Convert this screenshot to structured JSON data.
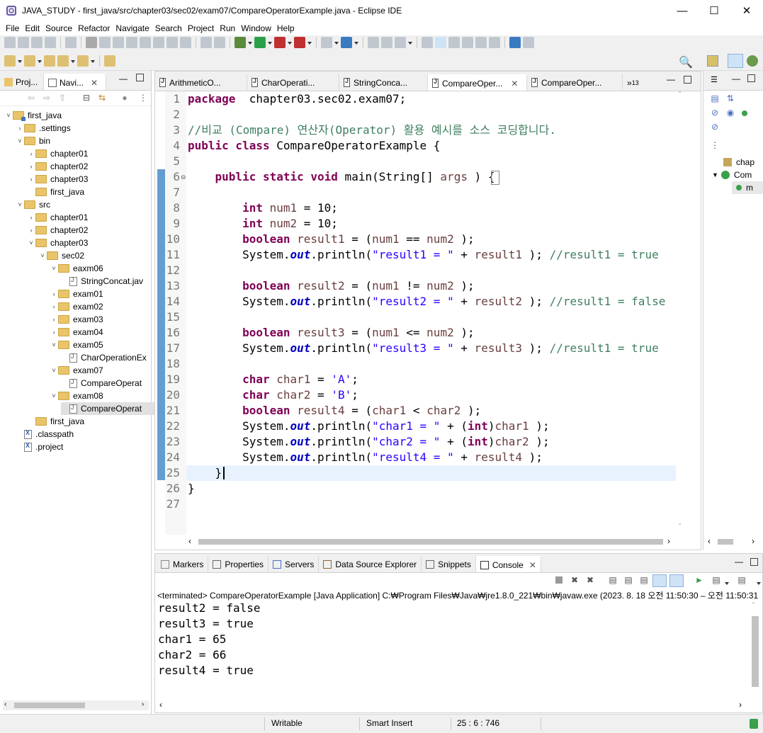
{
  "window": {
    "title": "JAVA_STUDY - first_java/src/chapter03/sec02/exam07/CompareOperatorExample.java - Eclipse IDE"
  },
  "menu": [
    "File",
    "Edit",
    "Source",
    "Refactor",
    "Navigate",
    "Search",
    "Project",
    "Run",
    "Window",
    "Help"
  ],
  "left_panel": {
    "tabs": [
      {
        "label": "Proj..."
      },
      {
        "label": "Navi..."
      }
    ],
    "tree": [
      {
        "label": "first_java",
        "depth": 0,
        "expanded": true,
        "icon": "project-icon"
      },
      {
        "label": ".settings",
        "depth": 1,
        "expanded": false,
        "icon": "folder-icon"
      },
      {
        "label": "bin",
        "depth": 1,
        "expanded": true,
        "icon": "folder-icon"
      },
      {
        "label": "chapter01",
        "depth": 2,
        "expanded": false,
        "icon": "folder-icon"
      },
      {
        "label": "chapter02",
        "depth": 2,
        "expanded": false,
        "icon": "folder-icon"
      },
      {
        "label": "chapter03",
        "depth": 2,
        "expanded": false,
        "icon": "folder-icon"
      },
      {
        "label": "first_java",
        "depth": 2,
        "expanded": null,
        "icon": "folder-icon"
      },
      {
        "label": "src",
        "depth": 1,
        "expanded": true,
        "icon": "folder-icon"
      },
      {
        "label": "chapter01",
        "depth": 2,
        "expanded": false,
        "icon": "folder-icon"
      },
      {
        "label": "chapter02",
        "depth": 2,
        "expanded": false,
        "icon": "folder-icon"
      },
      {
        "label": "chapter03",
        "depth": 2,
        "expanded": true,
        "icon": "folder-icon"
      },
      {
        "label": "sec02",
        "depth": 3,
        "expanded": true,
        "icon": "folder-icon"
      },
      {
        "label": "eaxm06",
        "depth": 4,
        "expanded": true,
        "icon": "folder-icon"
      },
      {
        "label": "StringConcat.jav",
        "depth": 5,
        "expanded": null,
        "icon": "java-file-icon"
      },
      {
        "label": "exam01",
        "depth": 4,
        "expanded": false,
        "icon": "folder-icon"
      },
      {
        "label": "exam02",
        "depth": 4,
        "expanded": false,
        "icon": "folder-icon"
      },
      {
        "label": "exam03",
        "depth": 4,
        "expanded": false,
        "icon": "folder-icon"
      },
      {
        "label": "exam04",
        "depth": 4,
        "expanded": false,
        "icon": "folder-icon"
      },
      {
        "label": "exam05",
        "depth": 4,
        "expanded": true,
        "icon": "folder-icon"
      },
      {
        "label": "CharOperationEx",
        "depth": 5,
        "expanded": null,
        "icon": "java-file-icon"
      },
      {
        "label": "exam07",
        "depth": 4,
        "expanded": true,
        "icon": "folder-icon"
      },
      {
        "label": "CompareOperat",
        "depth": 5,
        "expanded": null,
        "icon": "java-file-icon"
      },
      {
        "label": "exam08",
        "depth": 4,
        "expanded": true,
        "icon": "folder-icon"
      },
      {
        "label": "CompareOperat",
        "depth": 5,
        "expanded": null,
        "icon": "java-file-icon",
        "selected": true
      },
      {
        "label": "first_java",
        "depth": 2,
        "expanded": null,
        "icon": "folder-icon"
      },
      {
        "label": ".classpath",
        "depth": 1,
        "expanded": null,
        "icon": "xml-file-icon"
      },
      {
        "label": ".project",
        "depth": 1,
        "expanded": null,
        "icon": "xml-file-icon"
      }
    ]
  },
  "editor": {
    "tabs": [
      {
        "label": "ArithmeticO...",
        "active": false
      },
      {
        "label": "CharOperati...",
        "active": false
      },
      {
        "label": "StringConca...",
        "active": false
      },
      {
        "label": "CompareOper...",
        "active": true
      },
      {
        "label": "CompareOper...",
        "active": false
      }
    ],
    "overflow_label": "»",
    "overflow_count": "13",
    "lines": [
      {
        "n": "1",
        "tokens": [
          [
            "kw",
            "package"
          ],
          [
            "",
            "  chapter03.sec02.exam07;"
          ]
        ]
      },
      {
        "n": "2",
        "tokens": []
      },
      {
        "n": "3",
        "tokens": [
          [
            "cmt",
            "//비교 (Compare) 연산자(Operator) 활용 예시를 소스 코딩합니다."
          ]
        ]
      },
      {
        "n": "4",
        "tokens": [
          [
            "kw",
            "public class"
          ],
          [
            "",
            " CompareOperatorExample {"
          ]
        ]
      },
      {
        "n": "5",
        "tokens": []
      },
      {
        "n": "6",
        "tokens": [
          [
            "",
            "    "
          ],
          [
            "kw",
            "public static void"
          ],
          [
            "",
            " main(String[] "
          ],
          [
            "var",
            "args"
          ],
          [
            "",
            " ) {"
          ]
        ]
      },
      {
        "n": "7",
        "tokens": []
      },
      {
        "n": "8",
        "tokens": [
          [
            "",
            "        "
          ],
          [
            "kw",
            "int"
          ],
          [
            "",
            " "
          ],
          [
            "var",
            "num1"
          ],
          [
            "",
            " = 10;"
          ]
        ]
      },
      {
        "n": "9",
        "tokens": [
          [
            "",
            "        "
          ],
          [
            "kw",
            "int"
          ],
          [
            "",
            " "
          ],
          [
            "var",
            "num2"
          ],
          [
            "",
            " = 10;"
          ]
        ]
      },
      {
        "n": "10",
        "tokens": [
          [
            "",
            "        "
          ],
          [
            "kw",
            "boolean"
          ],
          [
            "",
            " "
          ],
          [
            "var",
            "result1"
          ],
          [
            "",
            " = ("
          ],
          [
            "var",
            "num1"
          ],
          [
            "",
            " == "
          ],
          [
            "var",
            "num2"
          ],
          [
            "",
            " );"
          ]
        ]
      },
      {
        "n": "11",
        "tokens": [
          [
            "",
            "        System."
          ],
          [
            "fld",
            "out"
          ],
          [
            "",
            ".println("
          ],
          [
            "str",
            "\"result1 = \""
          ],
          [
            "",
            " + "
          ],
          [
            "var",
            "result1"
          ],
          [
            "",
            " ); "
          ],
          [
            "cmt",
            "//result1 = true"
          ]
        ]
      },
      {
        "n": "12",
        "tokens": []
      },
      {
        "n": "13",
        "tokens": [
          [
            "",
            "        "
          ],
          [
            "kw",
            "boolean"
          ],
          [
            "",
            " "
          ],
          [
            "var",
            "result2"
          ],
          [
            "",
            " = ("
          ],
          [
            "var",
            "num1"
          ],
          [
            "",
            " != "
          ],
          [
            "var",
            "num2"
          ],
          [
            "",
            " );"
          ]
        ]
      },
      {
        "n": "14",
        "tokens": [
          [
            "",
            "        System."
          ],
          [
            "fld",
            "out"
          ],
          [
            "",
            ".println("
          ],
          [
            "str",
            "\"result2 = \""
          ],
          [
            "",
            " + "
          ],
          [
            "var",
            "result2"
          ],
          [
            "",
            " ); "
          ],
          [
            "cmt",
            "//result1 = false"
          ]
        ]
      },
      {
        "n": "15",
        "tokens": []
      },
      {
        "n": "16",
        "tokens": [
          [
            "",
            "        "
          ],
          [
            "kw",
            "boolean"
          ],
          [
            "",
            " "
          ],
          [
            "var",
            "result3"
          ],
          [
            "",
            " = ("
          ],
          [
            "var",
            "num1"
          ],
          [
            "",
            " <= "
          ],
          [
            "var",
            "num2"
          ],
          [
            "",
            " );"
          ]
        ]
      },
      {
        "n": "17",
        "tokens": [
          [
            "",
            "        System."
          ],
          [
            "fld",
            "out"
          ],
          [
            "",
            ".println("
          ],
          [
            "str",
            "\"result3 = \""
          ],
          [
            "",
            " + "
          ],
          [
            "var",
            "result3"
          ],
          [
            "",
            " ); "
          ],
          [
            "cmt",
            "//result1 = true"
          ]
        ]
      },
      {
        "n": "18",
        "tokens": []
      },
      {
        "n": "19",
        "tokens": [
          [
            "",
            "        "
          ],
          [
            "kw",
            "char"
          ],
          [
            "",
            " "
          ],
          [
            "var",
            "char1"
          ],
          [
            "",
            " = "
          ],
          [
            "str",
            "'A'"
          ],
          [
            "",
            ";"
          ]
        ]
      },
      {
        "n": "20",
        "tokens": [
          [
            "",
            "        "
          ],
          [
            "kw",
            "char"
          ],
          [
            "",
            " "
          ],
          [
            "var",
            "char2"
          ],
          [
            "",
            " = "
          ],
          [
            "str",
            "'B'"
          ],
          [
            "",
            ";"
          ]
        ]
      },
      {
        "n": "21",
        "tokens": [
          [
            "",
            "        "
          ],
          [
            "kw",
            "boolean"
          ],
          [
            "",
            " "
          ],
          [
            "var",
            "result4"
          ],
          [
            "",
            " = ("
          ],
          [
            "var",
            "char1"
          ],
          [
            "",
            " < "
          ],
          [
            "var",
            "char2"
          ],
          [
            "",
            " );"
          ]
        ]
      },
      {
        "n": "22",
        "tokens": [
          [
            "",
            "        System."
          ],
          [
            "fld",
            "out"
          ],
          [
            "",
            ".println("
          ],
          [
            "str",
            "\"char1 = \""
          ],
          [
            "",
            " + ("
          ],
          [
            "kw",
            "int"
          ],
          [
            "",
            ")"
          ],
          [
            "var",
            "char1"
          ],
          [
            "",
            " );"
          ]
        ]
      },
      {
        "n": "23",
        "tokens": [
          [
            "",
            "        System."
          ],
          [
            "fld",
            "out"
          ],
          [
            "",
            ".println("
          ],
          [
            "str",
            "\"char2 = \""
          ],
          [
            "",
            " + ("
          ],
          [
            "kw",
            "int"
          ],
          [
            "",
            ")"
          ],
          [
            "var",
            "char2"
          ],
          [
            "",
            " );"
          ]
        ]
      },
      {
        "n": "24",
        "tokens": [
          [
            "",
            "        System."
          ],
          [
            "fld",
            "out"
          ],
          [
            "",
            ".println("
          ],
          [
            "str",
            "\"result4 = \""
          ],
          [
            "",
            " + "
          ],
          [
            "var",
            "result4"
          ],
          [
            "",
            " );"
          ]
        ]
      },
      {
        "n": "25",
        "tokens": [
          [
            "",
            "    }"
          ]
        ]
      },
      {
        "n": "26",
        "tokens": [
          [
            "",
            "}"
          ]
        ]
      },
      {
        "n": "27",
        "tokens": []
      }
    ]
  },
  "outline": {
    "items": [
      {
        "label": "chap",
        "icon": "package-icon"
      },
      {
        "label": "Com",
        "icon": "class-icon"
      },
      {
        "label": "m",
        "icon": "method-icon"
      }
    ]
  },
  "bottom_panel": {
    "tabs": [
      {
        "label": "Markers",
        "icon": "markers-icon"
      },
      {
        "label": "Properties",
        "icon": "properties-icon"
      },
      {
        "label": "Servers",
        "icon": "servers-icon"
      },
      {
        "label": "Data Source Explorer",
        "icon": "data-source-icon"
      },
      {
        "label": "Snippets",
        "icon": "snippets-icon"
      },
      {
        "label": "Console",
        "icon": "console-icon",
        "active": true
      }
    ],
    "console_header": "<terminated> CompareOperatorExample [Java Application] C:₩Program Files₩Java₩jre1.8.0_221₩bin₩javaw.exe  (2023. 8. 18 오전 11:50:30 – 오전 11:50:31",
    "output": [
      "result2 = false",
      "result3 = true",
      "char1 = 65",
      "char2 = 66",
      "result4 = true"
    ]
  },
  "status": {
    "writable": "Writable",
    "insert_mode": "Smart Insert",
    "position": "25 : 6 : 746"
  }
}
